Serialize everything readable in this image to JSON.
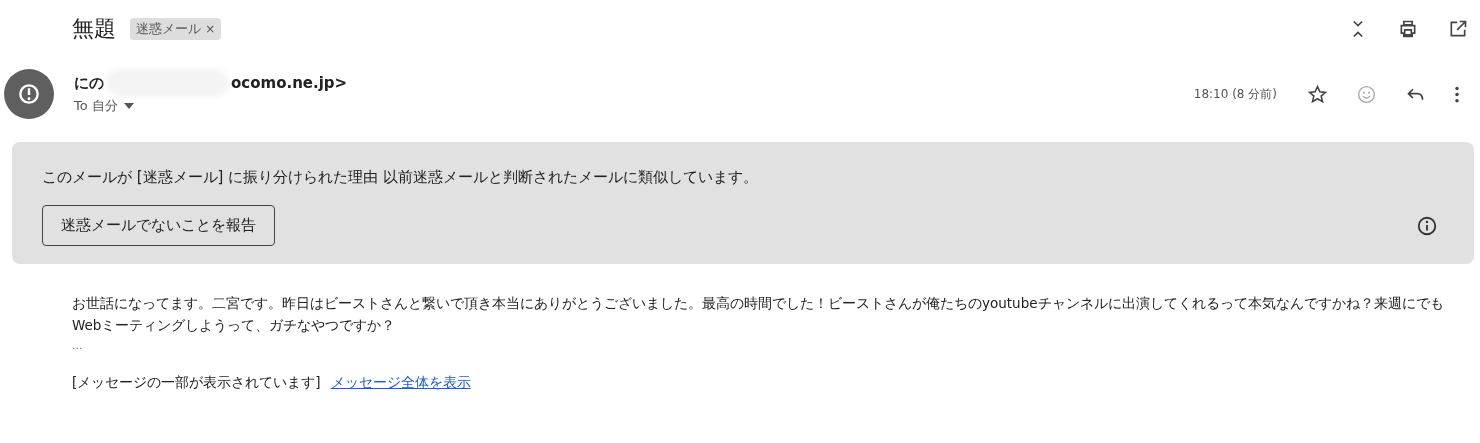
{
  "subject": "無題",
  "label": {
    "text": "迷惑メール",
    "remove": "×"
  },
  "sender": {
    "name": "にの",
    "address_visible": "ocomo.ne.jp>",
    "recipient": "To 自分"
  },
  "time": "18:10 (8 分前)",
  "spam_notice": {
    "text": "このメールが [迷惑メール] に振り分けられた理由 以前迷惑メールと判断されたメールに類似しています。",
    "button": "迷惑メールでないことを報告"
  },
  "body": {
    "text": "お世話になってます。二宮です。昨日はビーストさんと繋いで頂き本当にありがとうございました。最高の時間でした！ビーストさんが俺たちのyoutubeチャンネルに出演してくれるって本気なんですかね？来週にでもWebミーティングしようって、ガチなやつですか？",
    "ellipsis": "...",
    "clipped_note": "[メッセージの一部が表示されています]",
    "view_all_link": "メッセージ全体を表示"
  }
}
